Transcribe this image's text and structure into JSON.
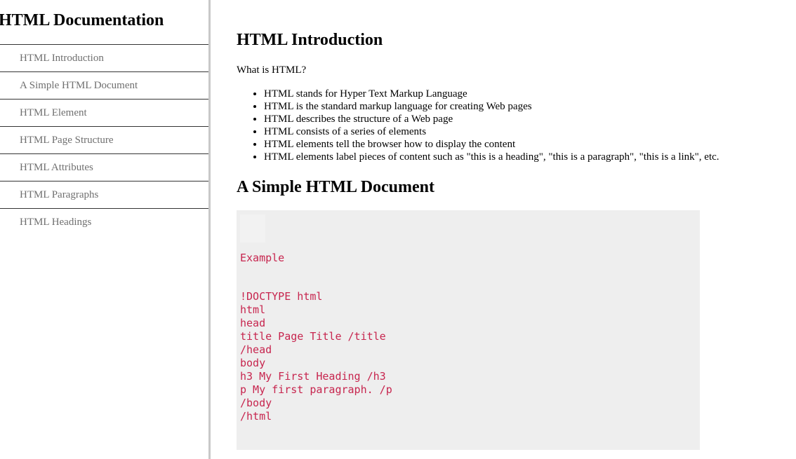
{
  "navbar": {
    "header": "HTML Documentation",
    "items": [
      {
        "label": "HTML Introduction"
      },
      {
        "label": "A Simple HTML Document"
      },
      {
        "label": "HTML Element"
      },
      {
        "label": "HTML Page Structure"
      },
      {
        "label": "HTML Attributes"
      },
      {
        "label": "HTML Paragraphs"
      },
      {
        "label": "HTML Headings"
      }
    ]
  },
  "main": {
    "intro": {
      "title": "HTML Introduction",
      "paragraph": "What is HTML?",
      "bullets": [
        "HTML stands for Hyper Text Markup Language",
        "HTML is the standard markup language for creating Web pages",
        "HTML describes the structure of a Web page",
        "HTML consists of a series of elements",
        "HTML elements tell the browser how to display the content",
        "HTML elements label pieces of content such as \"this is a heading\", \"this is a paragraph\", \"this is a link\", etc."
      ]
    },
    "simple_doc": {
      "title": "A Simple HTML Document",
      "example_label": "Example",
      "code_lines": [
        "!DOCTYPE html",
        "html",
        "head",
        "title Page Title /title",
        "/head",
        "body",
        "h3 My First Heading /h3",
        "p My first paragraph. /p",
        "/body",
        "/html"
      ]
    }
  },
  "colors": {
    "code_text": "#c7254e",
    "code_background": "#eeeeee",
    "nav_text": "#6f6f6f",
    "divider": "#c8c8c8"
  }
}
